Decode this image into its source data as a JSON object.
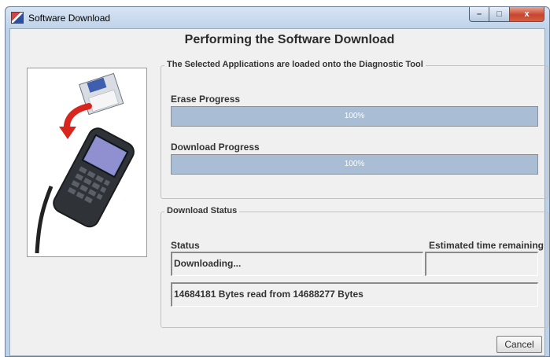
{
  "window": {
    "title": "Software Download",
    "icon": "app-icon",
    "controls": {
      "minimize": "–",
      "maximize": "□",
      "close": "x"
    }
  },
  "heading": "Performing the Software Download",
  "load_group": {
    "legend": "The Selected Applications are loaded onto the Diagnostic Tool",
    "erase": {
      "label": "Erase Progress",
      "percent": 100,
      "text": "100%"
    },
    "download": {
      "label": "Download Progress",
      "percent": 100,
      "text": "100%"
    }
  },
  "status_group": {
    "legend": "Download Status",
    "status_label": "Status",
    "eta_label": "Estimated time remaining",
    "status_value": "Downloading...",
    "eta_value": "",
    "bytes_text": "14684181 Bytes read from 14688277 Bytes"
  },
  "buttons": {
    "cancel": "Cancel"
  },
  "illustration": "diagnostic-tool-with-floppy-disk-illustration",
  "colors": {
    "progress_fill": "#a9bed4",
    "window_frame": "#bcd1ea",
    "dialog_background": "#f0f0f0",
    "close_button": "#c8452e"
  }
}
